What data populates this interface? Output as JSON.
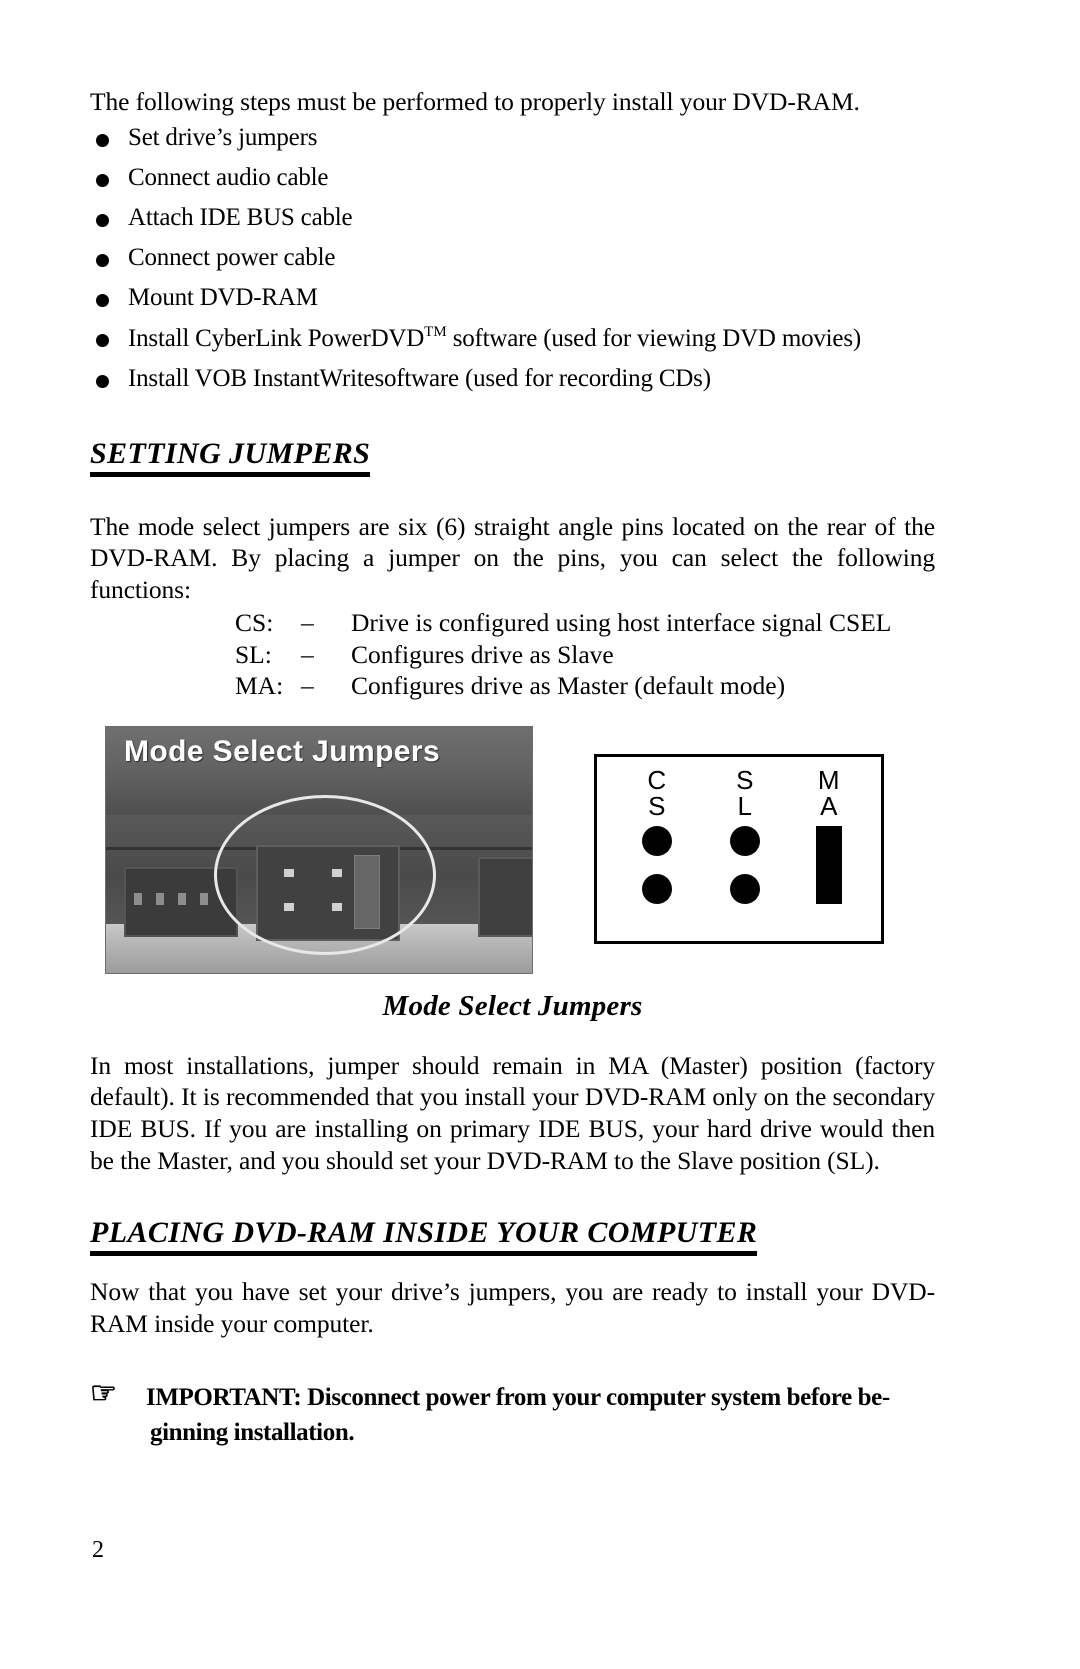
{
  "document": {
    "page_number": "2",
    "intro": "The following steps must be performed to properly install your DVD-RAM.",
    "steps": [
      "Set drive’s jumpers",
      "Connect  audio  cable",
      "Attach IDE BUS cable",
      "Connect power cable",
      "Mount DVD-RAM",
      "Install VOB InstantWritesoftware (used for recording CDs)"
    ],
    "step_powerdvd": {
      "before": "Install CyberLink PowerDVD",
      "superscript": "TM",
      "after": " software (used for viewing DVD movies)"
    },
    "sections": [
      {
        "heading": "SETTING  JUMPERS",
        "paragraph": "The mode select jumpers are six (6) straight angle pins located on the rear of the DVD-RAM. By placing a jumper on the pins, you can select the following functions:",
        "definitions": [
          {
            "key": "CS:",
            "dash": "–",
            "value": "Drive is configured using host interface signal CSEL"
          },
          {
            "key": "SL:",
            "dash": "–",
            "value": "Configures drive as Slave"
          },
          {
            "key": "MA:",
            "dash": "–",
            "value": "Configures drive as Master (default mode)"
          }
        ],
        "figure": {
          "photo_label": "Mode Select Jumpers",
          "caption": "Mode Select Jumpers",
          "jumper_diagram": {
            "columns": [
              {
                "line1": "C",
                "line2": "S",
                "state": "open"
              },
              {
                "line1": "S",
                "line2": "L",
                "state": "open"
              },
              {
                "line1": "M",
                "line2": "A",
                "state": "jumpered"
              }
            ]
          }
        },
        "paragraph_after": "In most installations, jumper should remain in MA (Master) position (factory default). It is recommended that you install your DVD-RAM only on the secondary IDE BUS. If you are installing on primary IDE BUS, your hard drive would then be the Master, and you should set your DVD-RAM to the Slave position (SL)."
      },
      {
        "heading": "PLACING DVD-RAM INSIDE YOUR  COMPUTER",
        "paragraph": "Now that you have set your drive’s  jumpers, you are ready to install your DVD-RAM inside your computer."
      }
    ],
    "important_note": {
      "icon": "pointing-hand-icon",
      "line1": "IMPORTANT: Disconnect power from your computer system before be-",
      "line2": "ginning installation."
    }
  }
}
